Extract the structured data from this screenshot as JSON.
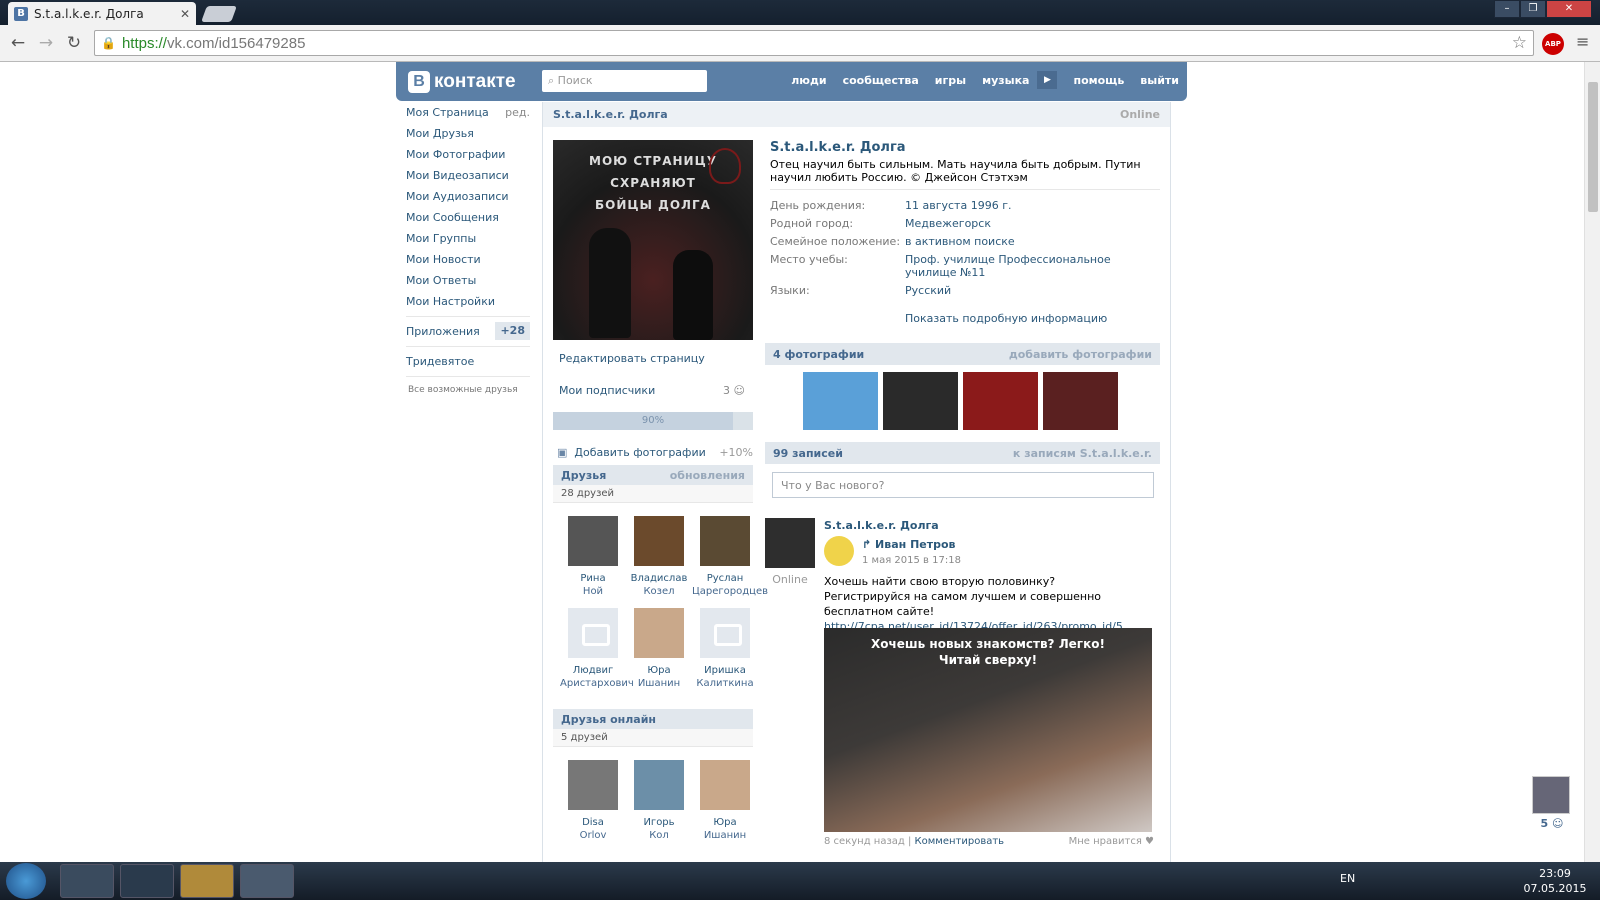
{
  "browser": {
    "tab_title": "S.t.a.l.k.e.r. Долга",
    "url_scheme": "https://",
    "url_rest": "vk.com/id156479285",
    "abp_label": "ABP"
  },
  "vk": {
    "logo": "контакте",
    "logo_b": "В",
    "search_placeholder": "Поиск",
    "nav": [
      "люди",
      "сообщества",
      "игры",
      "музыка",
      "помощь",
      "выйти"
    ],
    "left_menu": [
      {
        "label": "Моя Страница",
        "extra": "ред."
      },
      {
        "label": "Мои Друзья"
      },
      {
        "label": "Мои Фотографии"
      },
      {
        "label": "Мои Видеозаписи"
      },
      {
        "label": "Мои Аудиозаписи"
      },
      {
        "label": "Мои Сообщения"
      },
      {
        "label": "Мои Группы"
      },
      {
        "label": "Мои Новости"
      },
      {
        "label": "Мои Ответы"
      },
      {
        "label": "Мои Настройки"
      }
    ],
    "apps": {
      "label": "Приложения",
      "count": "+28"
    },
    "tridevyatoe": "Тридевятое",
    "all_friends": "Все возможные друзья",
    "profile": {
      "header_name": "S.t.a.l.k.e.r. Долга",
      "online": "Online",
      "avatar_caption": [
        "МОЮ СТРАНИЦУ",
        "СХРАНЯЮТ",
        "БОЙЦЫ ДОЛГА"
      ],
      "name": "S.t.a.l.k.e.r. Долга",
      "status": "Отец научил быть сильным. Мать научила быть добрым. Путин научил любить Россию. © Джейсон Стэтхэм",
      "info": [
        {
          "k": "День рождения:",
          "v": "11 августа 1996 г."
        },
        {
          "k": "Родной город:",
          "v": "Медвежегорск"
        },
        {
          "k": "Семейное положение:",
          "v": "в активном поиске"
        },
        {
          "k": "Место учебы:",
          "v": "Проф. училище Профессиональное училище №11"
        },
        {
          "k": "Языки:",
          "v": "Русский"
        }
      ],
      "show_more": "Показать подробную информацию",
      "edit_page": "Редактировать страницу",
      "subscribers": {
        "label": "Мои подписчики",
        "count": "3"
      },
      "progress": {
        "label": "90%",
        "value": 0.9
      },
      "add_photos": {
        "label": "Добавить фотографии",
        "pct": "+10%"
      }
    },
    "friends": {
      "title": "Друзья",
      "right": "обновления",
      "count": "28 друзей",
      "list": [
        {
          "first": "Рина",
          "last": "Ной",
          "color": "#555"
        },
        {
          "first": "Владислав",
          "last": "Козел",
          "color": "#6b4a2c"
        },
        {
          "first": "Руслан",
          "last": "Царегородцев",
          "color": "#5a4a33"
        },
        {
          "first": "Людвиг",
          "last": "Аристархович",
          "color": "cam"
        },
        {
          "first": "Юра",
          "last": "Ишанин",
          "color": "#c9a88a"
        },
        {
          "first": "Иришка",
          "last": "Калиткина",
          "color": "cam"
        }
      ]
    },
    "friends_online": {
      "title": "Друзья онлайн",
      "count": "5 друзей",
      "list": [
        {
          "first": "Disa",
          "last": "Orlov",
          "color": "#777"
        },
        {
          "first": "Игорь",
          "last": "Кол",
          "color": "#6c8fa8"
        },
        {
          "first": "Юра",
          "last": "Ишанин",
          "color": "#c9a88a"
        }
      ]
    },
    "photos": {
      "title": "4 фотографии",
      "right": "добавить фотографии",
      "colors": [
        "#5aa0d8",
        "#2a2a2a",
        "#8b1a1a",
        "#5a2020"
      ]
    },
    "wall": {
      "title": "99 записей",
      "right": "к записям S.t.a.l.k.e.r.",
      "placeholder": "Что у Вас нового?",
      "post": {
        "author": "S.t.a.l.k.e.r. Долга",
        "online": "Online",
        "repost_name": "Иван Петров",
        "date": "1 мая 2015 в 17:18",
        "text": "Хочешь найти свою вторую половинку? Регистрируйся на самом лучшем и совершенно бесплатном сайте!",
        "link": "http://7cpa.net/user_id/13724/offer_id/263/promo_id/5..",
        "ad_text": [
          "Хочешь новых знакомств? Легко!",
          "Читай сверху!"
        ],
        "time": "8 секунд назад",
        "comment": "Комментировать",
        "like": "Мне нравится"
      }
    },
    "chat_count": "5"
  },
  "taskbar": {
    "lang": "EN",
    "time": "23:09",
    "date": "07.05.2015"
  }
}
